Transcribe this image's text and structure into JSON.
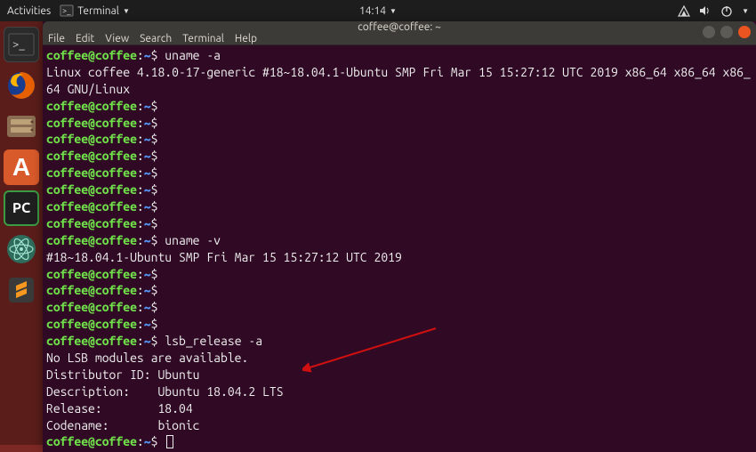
{
  "topbar": {
    "activities": "Activities",
    "app_label": "Terminal",
    "time": "14:14"
  },
  "dock": {
    "software_letter": "A",
    "pycharm_label": "PC"
  },
  "window": {
    "title": "coffee@coffee: ~"
  },
  "menubar": {
    "file": "File",
    "edit": "Edit",
    "view": "View",
    "search": "Search",
    "terminal": "Terminal",
    "help": "Help"
  },
  "prompt": {
    "userhost": "coffee@coffee",
    "colon": ":",
    "path": "~",
    "dollar": "$"
  },
  "commands": {
    "uname_a": "uname -a",
    "uname_v": "uname -v",
    "lsb": "lsb_release -a"
  },
  "outputs": {
    "uname_a": "Linux coffee 4.18.0-17-generic #18~18.04.1-Ubuntu SMP Fri Mar 15 15:27:12 UTC 2019 x86_64 x86_64 x86_64 GNU/Linux",
    "uname_v": "#18~18.04.1-Ubuntu SMP Fri Mar 15 15:27:12 UTC 2019",
    "lsb_no_modules": "No LSB modules are available.",
    "lsb_distributor": "Distributor ID:\tUbuntu",
    "lsb_description": "Description:\tUbuntu 18.04.2 LTS",
    "lsb_release": "Release:\t18.04",
    "lsb_codename": "Codename:\tbionic"
  }
}
